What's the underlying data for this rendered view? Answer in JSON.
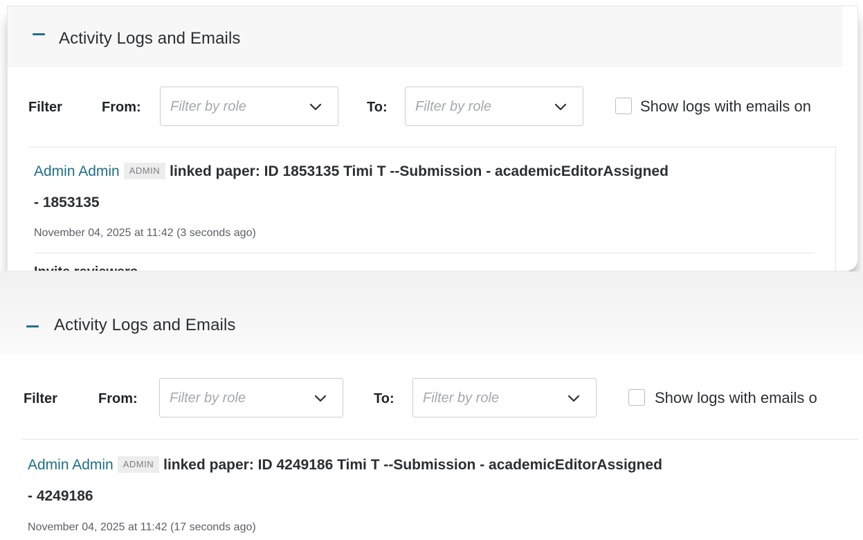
{
  "panel_a": {
    "title": "Activity Logs and Emails",
    "filter": {
      "label": "Filter",
      "from_label": "From:",
      "to_label": "To:",
      "from_placeholder": "Filter by role",
      "to_placeholder": "Filter by role",
      "checkbox_label": "Show logs with emails on"
    },
    "log": {
      "user": "Admin Admin",
      "role_badge": "ADMIN",
      "action": "linked paper: ID 1853135 Timi T --Submission - academicEditorAssigned",
      "action_cont": "- 1853135",
      "timestamp": "November 04, 2025 at 11:42 (3 seconds ago)"
    },
    "next_item": "Invite reviewers"
  },
  "panel_b": {
    "title": "Activity Logs and Emails",
    "filter": {
      "label": "Filter",
      "from_label": "From:",
      "to_label": "To:",
      "from_placeholder": "Filter by role",
      "to_placeholder": "Filter by role",
      "checkbox_label": "Show logs with emails o"
    },
    "log": {
      "user": "Admin Admin",
      "role_badge": "ADMIN",
      "action": "linked paper: ID 4249186 Timi T --Submission - academicEditorAssigned",
      "action_cont": "- 4249186",
      "timestamp": "November 04, 2025 at 11:42 (17 seconds ago)"
    }
  },
  "colors": {
    "accent": "#1f6f86",
    "badge_bg": "#ededed",
    "placeholder": "#a4a8ae"
  }
}
